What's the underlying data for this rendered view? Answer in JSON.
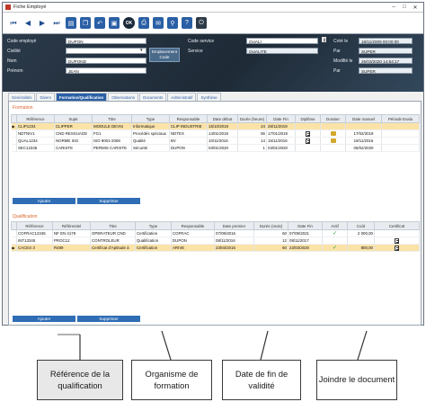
{
  "window": {
    "title": "Fiche Employé"
  },
  "header": {
    "code_employe_label": "Code employé",
    "code_employe_value": "DUPON",
    "civilite_label": "Civilité",
    "civilite_value": "",
    "nom_label": "Nom",
    "nom_value": "DUPOND",
    "prenom_label": "Prénom",
    "prenom_value": "JEAN",
    "emplacement_btn": "Emplacement Code",
    "code_service_label": "Code service",
    "code_service_value": "QUALI",
    "service_label": "Service",
    "service_value": "QUALITE",
    "cree_le_label": "Créé le",
    "cree_le_value": "18/11/2009 00:00:00",
    "par1_label": "Par",
    "par1_value": "SUPER",
    "modifie_le_label": "Modifié le",
    "modifie_le_value": "25/03/2020 14:54:17",
    "par2_label": "Par",
    "par2_value": "SUPER"
  },
  "tabs": [
    "Généralités",
    "Divers",
    "Formation/Qualification",
    "Observations",
    "Documents",
    "Administratif",
    "Synthèse"
  ],
  "formation": {
    "title": "Formation",
    "headers": [
      "Référence",
      "Sujet",
      "Titre",
      "Type",
      "Responsable",
      "Date début",
      "Durée (heure)",
      "Date Fin",
      "Diplôme",
      "Dossier",
      "Date manuel",
      "Période Evalu"
    ],
    "rows": [
      [
        "CLIP1234",
        "CLIPPER",
        "MODULE DEVIS",
        "Informatique",
        "CLIP INDUSTRIE",
        "15/10/2019",
        "24",
        "28/11/2019",
        "",
        "",
        "",
        ""
      ],
      [
        "NDTNIV1",
        "CND RESSUAGE",
        "FG1",
        "Procédés spéciaux",
        "NDTEX",
        "14/01/2019",
        "56",
        "17/01/2019",
        "doc",
        "folder",
        "17/02/2019",
        ""
      ],
      [
        "QUAL1234",
        "NORME ISO",
        "ISO 9001-2008",
        "Qualité",
        "BV",
        "10/11/2016",
        "14",
        "15/11/2016",
        "doc",
        "folder",
        "18/11/2016",
        ""
      ],
      [
        "SEC12345",
        "CARISTE",
        "PERMIS CARISTE",
        "Sécurité",
        "DUPON",
        "03/01/2020",
        "1",
        "03/01/2020",
        "",
        "",
        "06/02/2020",
        ""
      ]
    ],
    "add_button": "Ajouter",
    "delete_button": "Supprimer"
  },
  "qualification": {
    "title": "Qualification",
    "headers": [
      "Référence",
      "Référentiel",
      "Titre",
      "Type",
      "Responsable",
      "Date premier",
      "Durée (mois)",
      "Date Fin",
      "Actif",
      "Coût",
      "Certificat"
    ],
    "rows": [
      [
        "COFRAC12345",
        "NF EN 4179",
        "OPERATEUR CND",
        "Certification",
        "COFRAC",
        "07/09/2016",
        "60",
        "07/09/2021",
        "check",
        "2 000,00",
        ""
      ],
      [
        "INT13345",
        "PROC12",
        "CONTROLEUR",
        "Qualification",
        "DUPON",
        "08/11/2016",
        "12",
        "08/11/2017",
        "",
        "",
        "doc"
      ],
      [
        "CACES 3",
        "R489",
        "Certificat d'Aptitude à",
        "Certification",
        "ARIVE",
        "23/03/2015",
        "60",
        "23/03/2020",
        "check",
        "800,00",
        "doc"
      ]
    ],
    "add_button": "Ajouter",
    "delete_button": "Supprimer"
  },
  "callouts": [
    "Référence de la qualification",
    "Organisme de formation",
    "Date de fin de validité",
    "Joindre le document"
  ]
}
